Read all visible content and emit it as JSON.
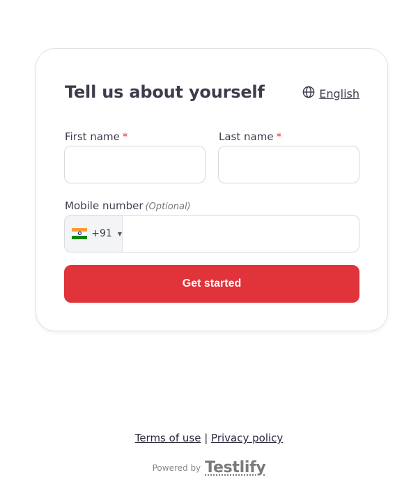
{
  "form": {
    "title": "Tell us about yourself",
    "language": "English",
    "first_name_label": "First name",
    "last_name_label": "Last name",
    "required_mark": "*",
    "first_name_value": "",
    "last_name_value": "",
    "mobile_label": "Mobile number",
    "mobile_optional": "(Optional)",
    "dial_code": "+91",
    "country_flag": "india-flag-icon",
    "mobile_value": "",
    "submit_label": "Get started"
  },
  "footer": {
    "terms": "Terms of use",
    "separator": "|",
    "privacy": "Privacy policy",
    "powered_by": "Powered by",
    "brand": "Testlify"
  },
  "colors": {
    "accent": "#e0333a",
    "text": "#3c3c4c"
  }
}
